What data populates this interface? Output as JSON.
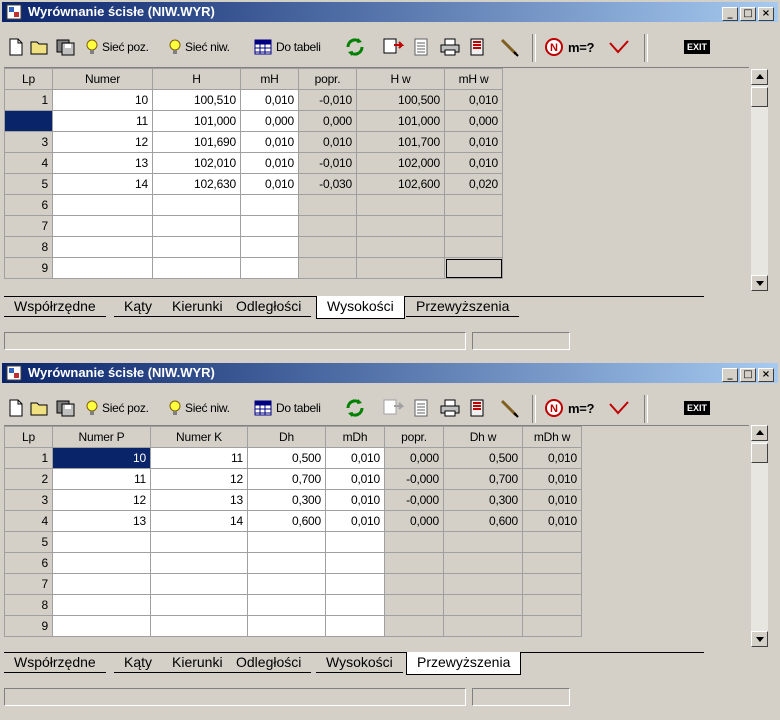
{
  "windows": [
    {
      "title": "Wyrównanie ścisłe (NIW.WYR)",
      "toolbar": {
        "siec_poz": "Sieć poz.",
        "siec_niw": "Sieć niw.",
        "do_tabeli": "Do tabeli",
        "m_label": "m=?",
        "exit_label": "EXIT"
      },
      "columns": [
        "Lp",
        "Numer",
        "H",
        "mH",
        "popr.",
        "H w",
        "mH w"
      ],
      "rows": [
        [
          "1",
          "10",
          "100,510",
          "0,010",
          "-0,010",
          "100,500",
          "0,010"
        ],
        [
          "2",
          "11",
          "101,000",
          "0,000",
          "0,000",
          "101,000",
          "0,000"
        ],
        [
          "3",
          "12",
          "101,690",
          "0,010",
          "0,010",
          "101,700",
          "0,010"
        ],
        [
          "4",
          "13",
          "102,010",
          "0,010",
          "-0,010",
          "102,000",
          "0,010"
        ],
        [
          "5",
          "14",
          "102,630",
          "0,010",
          "-0,030",
          "102,600",
          "0,020"
        ],
        [
          "6",
          "",
          "",
          "",
          "",
          "",
          ""
        ],
        [
          "7",
          "",
          "",
          "",
          "",
          "",
          ""
        ],
        [
          "8",
          "",
          "",
          "",
          "",
          "",
          ""
        ],
        [
          "9",
          "",
          "",
          "",
          "",
          "",
          ""
        ]
      ],
      "tabs": [
        "Współrzędne",
        "Kąty",
        "Kierunki",
        "Odległości",
        "Wysokości",
        "Przewyższenia"
      ],
      "active_tab": "Wysokości"
    },
    {
      "title": "Wyrównanie ścisłe (NIW.WYR)",
      "toolbar": {
        "siec_poz": "Sieć poz.",
        "siec_niw": "Sieć niw.",
        "do_tabeli": "Do tabeli",
        "m_label": "m=?",
        "exit_label": "EXIT"
      },
      "columns": [
        "Lp",
        "Numer P",
        "Numer K",
        "Dh",
        "mDh",
        "popr.",
        "Dh w",
        "mDh w"
      ],
      "rows": [
        [
          "1",
          "10",
          "11",
          "0,500",
          "0,010",
          "0,000",
          "0,500",
          "0,010"
        ],
        [
          "2",
          "11",
          "12",
          "0,700",
          "0,010",
          "-0,000",
          "0,700",
          "0,010"
        ],
        [
          "3",
          "12",
          "13",
          "0,300",
          "0,010",
          "-0,000",
          "0,300",
          "0,010"
        ],
        [
          "4",
          "13",
          "14",
          "0,600",
          "0,010",
          "0,000",
          "0,600",
          "0,010"
        ],
        [
          "5",
          "",
          "",
          "",
          "",
          "",
          "",
          ""
        ],
        [
          "6",
          "",
          "",
          "",
          "",
          "",
          "",
          ""
        ],
        [
          "7",
          "",
          "",
          "",
          "",
          "",
          "",
          ""
        ],
        [
          "8",
          "",
          "",
          "",
          "",
          "",
          "",
          ""
        ],
        [
          "9",
          "",
          "",
          "",
          "",
          "",
          "",
          ""
        ]
      ],
      "tabs": [
        "Współrzędne",
        "Kąty",
        "Kierunki",
        "Odległości",
        "Wysokości",
        "Przewyższenia"
      ],
      "active_tab": "Przewyższenia"
    }
  ],
  "colors": {
    "title_start": "#0a246a",
    "title_end": "#a6caf0",
    "selection": "#0a246a",
    "face": "#d4d0c8"
  },
  "icons": [
    "app-icon",
    "new-file-icon",
    "open-folder-icon",
    "save-icon",
    "bulb-icon",
    "table-icon",
    "refresh-icon",
    "export-icon",
    "document-icon",
    "print-icon",
    "report-icon",
    "pencil-icon",
    "north-icon",
    "checkmark-icon",
    "exit-icon"
  ]
}
